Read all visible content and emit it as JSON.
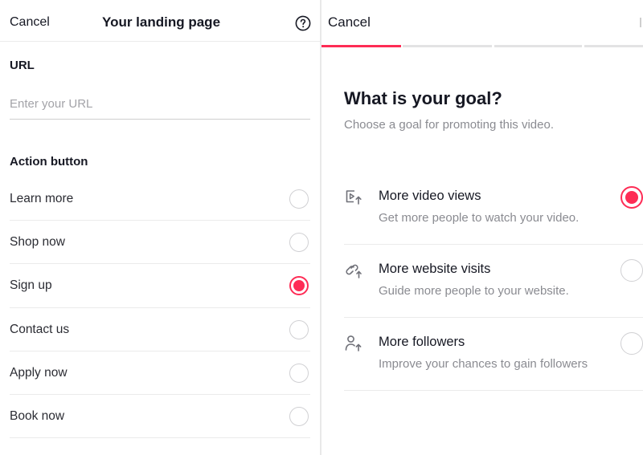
{
  "colors": {
    "accent": "#fe2c55",
    "divider": "#ebebeb",
    "muted": "#8a8b91"
  },
  "landing": {
    "cancel_label": "Cancel",
    "title": "Your landing page",
    "help_icon": "question-circle-icon",
    "url_label": "URL",
    "url_placeholder": "Enter your URL",
    "url_value": "",
    "action_label": "Action button",
    "options": [
      {
        "label": "Learn more",
        "selected": false
      },
      {
        "label": "Shop now",
        "selected": false
      },
      {
        "label": "Sign up",
        "selected": true
      },
      {
        "label": "Contact us",
        "selected": false
      },
      {
        "label": "Apply now",
        "selected": false
      },
      {
        "label": "Book now",
        "selected": false
      }
    ]
  },
  "goal": {
    "cancel_label": "Cancel",
    "step_current": 1,
    "step_total": 4,
    "title": "What is your goal?",
    "subtitle": "Choose a goal for promoting this video.",
    "options": [
      {
        "title": "More video views",
        "subtitle": "Get more people to watch your video.",
        "icon": "video-play-icon",
        "selected": true
      },
      {
        "title": "More website visits",
        "subtitle": "Guide more people to your website.",
        "icon": "link-icon",
        "selected": false
      },
      {
        "title": "More followers",
        "subtitle": "Improve your chances to gain followers",
        "icon": "user-follow-icon",
        "selected": false
      }
    ]
  }
}
